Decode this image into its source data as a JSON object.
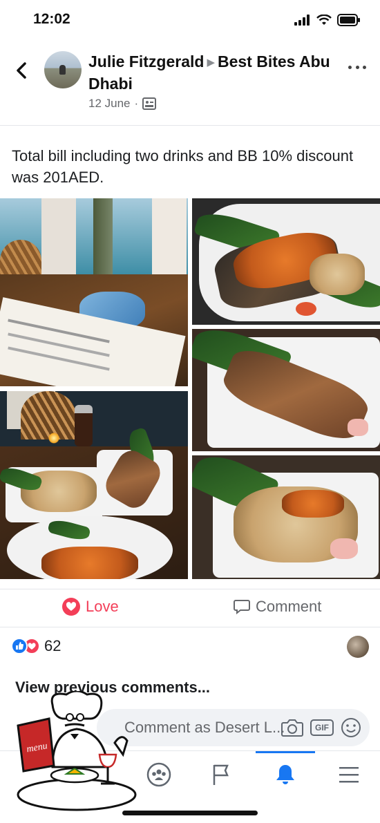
{
  "status": {
    "time": "12:02"
  },
  "header": {
    "author": "Julie Fitzgerald",
    "group": "Best Bites Abu Dhabi",
    "date": "12 June",
    "separator": "·"
  },
  "post": {
    "text": "Total bill including two drinks and BB 10% discount was 201AED."
  },
  "actions": {
    "love_label": "Love",
    "comment_label": "Comment"
  },
  "reactions": {
    "count": "62"
  },
  "comments": {
    "view_previous": "View previous comments...",
    "composer_placeholder": "Comment as Desert L..."
  },
  "logo": {
    "text": "menu"
  },
  "colors": {
    "love": "#f33e58",
    "like": "#1877f2",
    "secondary_text": "#65676b",
    "active_nav": "#1877f2"
  },
  "icons": {
    "back": "chevron-left-icon",
    "more": "more-dots-icon",
    "photo": "photo-album-icon",
    "love": "heart-icon",
    "comment": "speech-bubble-icon",
    "camera": "camera-icon",
    "gif": "gif-icon",
    "emoji": "emoji-icon",
    "groups": "groups-icon",
    "pages": "flag-icon",
    "notifications": "bell-icon",
    "menu": "hamburger-icon"
  }
}
